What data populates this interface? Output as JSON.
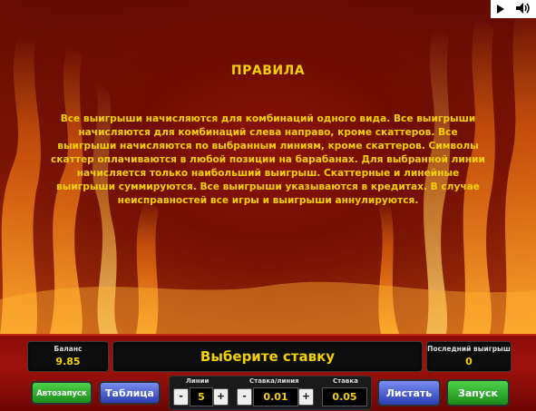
{
  "rules": {
    "title": "ПРАВИЛА",
    "text": "Все выигрыши начисляются для комбинаций одного вида. Все выигрыши начисляются для комбинаций слева направо, кроме скаттеров. Все выигрыши начисляются по выбранным линиям, кроме скаттеров. Символы скаттер оплачиваются в любой позиции на барабанах. Для выбранной линии начисляется только наибольший выигрыш. Скаттерные и линейные выигрыши суммируются. Все выигрыши указываются в кредитах. В случае неисправностей все игры и выигрыши аннулируются."
  },
  "top_icons": [
    "play-icon",
    "speaker-icon"
  ],
  "panel": {
    "balance_label": "Баланс",
    "balance_value": "9.85",
    "message": "Выберите ставку",
    "last_win_label": "Последний выигрыш",
    "last_win_value": "0",
    "lines_label": "Линии",
    "lines_value": "5",
    "bet_per_line_label": "Ставка/линия",
    "bet_per_line_value": "0.01",
    "bet_label": "Ставка",
    "bet_value": "0.05",
    "minus": "-",
    "plus": "+"
  },
  "buttons": {
    "autostart": "Автозапуск",
    "paytable": "Таблица",
    "flip": "Листать",
    "start": "Запуск"
  },
  "colors": {
    "text_yellow": "#f3d000",
    "panel_red": "#a0120c",
    "green_button": "#1b8a19",
    "blue_button": "#2b3db0"
  }
}
